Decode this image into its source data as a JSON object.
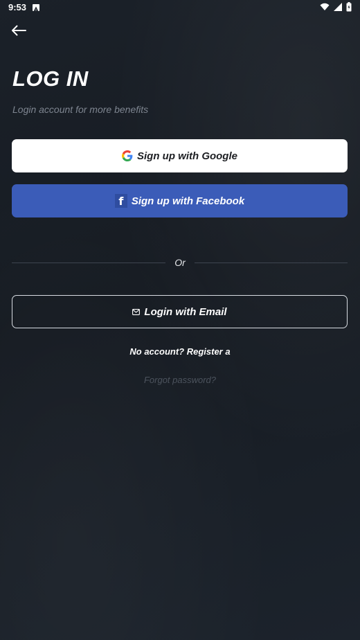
{
  "status_bar": {
    "time": "9:53"
  },
  "header": {
    "back_icon": "arrow-left-icon"
  },
  "login": {
    "title": "LOG IN",
    "subtitle": "Login account for more benefits",
    "google_button_label": "Sign up with Google",
    "facebook_button_label": "Sign up with Facebook",
    "divider_text": "Or",
    "email_button_label": "Login with Email",
    "register_text": "No account? Register a",
    "forgot_password_text": "Forgot password?"
  },
  "colors": {
    "background": "#181d24",
    "facebook_blue": "#3b5cb8",
    "muted_text": "#7e8590",
    "forgot_text": "#4c535d"
  }
}
